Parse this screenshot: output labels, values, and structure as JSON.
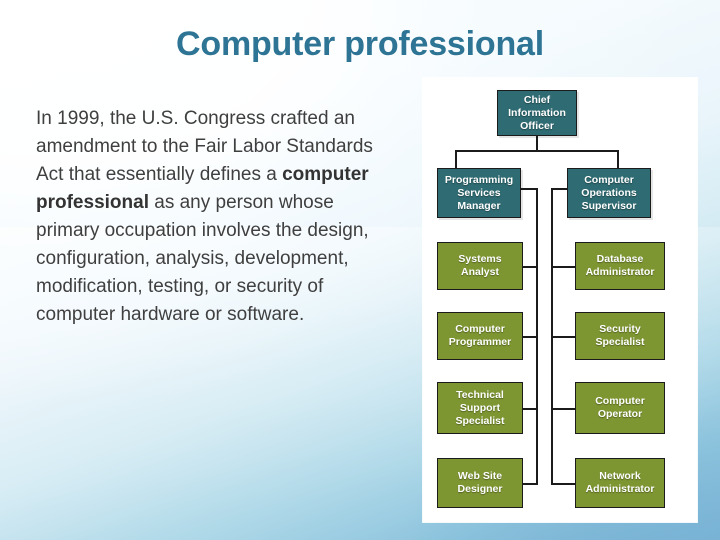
{
  "slide": {
    "title": "Computer professional",
    "body_before_bold": "In 1999, the U.S. Congress crafted an amendment to the Fair Labor Standards Act that essentially defines a ",
    "body_bold": "computer professional",
    "body_after_bold": " as any person whose primary occupation involves the design, configuration, analysis, development, modification, testing, or security of computer hardware or software."
  },
  "colors": {
    "title": "#2e7495",
    "body_text": "#3f3f3f",
    "manager_box": "#2f6b72",
    "staff_box": "#7e9632",
    "connector": "#1b1b1b",
    "panel_background": "#ffffff",
    "slide_background_top": "#f9fdff",
    "slide_background_bottom": "#79b3d6"
  },
  "org_chart": {
    "type": "organization-chart",
    "root": {
      "id": "cio",
      "label": "Chief Information Officer",
      "level": 0,
      "style": "teal"
    },
    "managers": [
      {
        "id": "programming-services-manager",
        "label": "Programming Services Manager",
        "level": 1,
        "style": "teal",
        "column": "left"
      },
      {
        "id": "computer-operations-supervisor",
        "label": "Computer Operations Supervisor",
        "level": 1,
        "style": "teal",
        "column": "right"
      }
    ],
    "staff_left": [
      {
        "id": "systems-analyst",
        "label": "Systems Analyst",
        "level": 2,
        "style": "green",
        "reports_to": "programming-services-manager"
      },
      {
        "id": "computer-programmer",
        "label": "Computer Programmer",
        "level": 2,
        "style": "green",
        "reports_to": "programming-services-manager"
      },
      {
        "id": "technical-support-specialist",
        "label": "Technical Support Specialist",
        "level": 2,
        "style": "green",
        "reports_to": "programming-services-manager"
      },
      {
        "id": "web-site-designer",
        "label": "Web Site Designer",
        "level": 2,
        "style": "green",
        "reports_to": "programming-services-manager"
      }
    ],
    "staff_right": [
      {
        "id": "database-administrator",
        "label": "Database Administrator",
        "level": 2,
        "style": "green",
        "reports_to": "computer-operations-supervisor"
      },
      {
        "id": "security-specialist",
        "label": "Security Specialist",
        "level": 2,
        "style": "green",
        "reports_to": "computer-operations-supervisor"
      },
      {
        "id": "computer-operator",
        "label": "Computer Operator",
        "level": 2,
        "style": "green",
        "reports_to": "computer-operations-supervisor"
      },
      {
        "id": "network-administrator",
        "label": "Network Administrator",
        "level": 2,
        "style": "green",
        "reports_to": "computer-operations-supervisor"
      }
    ]
  }
}
